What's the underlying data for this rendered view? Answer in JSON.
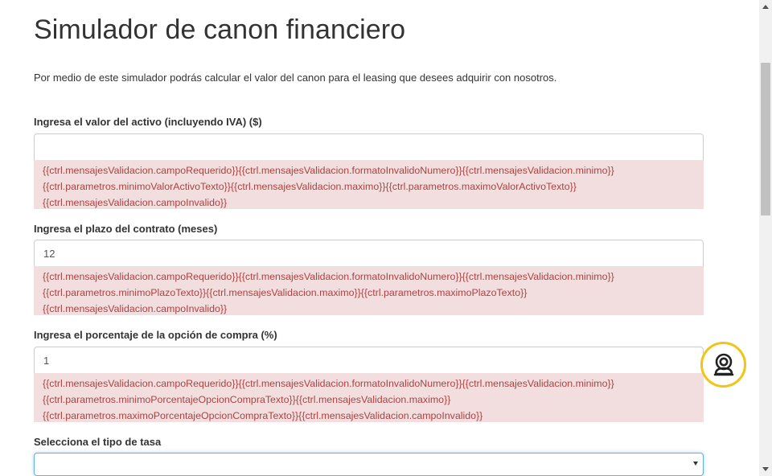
{
  "page": {
    "title": "Simulador de canon financiero",
    "intro": "Por medio de este simulador podrás calcular el valor del canon para el leasing que desees adquirir con nosotros."
  },
  "fields": [
    {
      "label": "Ingresa el valor del activo (incluyendo IVA) ($)",
      "value": "",
      "errors": [
        "{{ctrl.mensajesValidacion.campoRequerido}}{{ctrl.mensajesValidacion.formatoInvalidoNumero}}{{ctrl.mensajesValidacion.minimo}}",
        "{{ctrl.parametros.minimoValorActivoTexto}}{{ctrl.mensajesValidacion.maximo}}{{ctrl.parametros.maximoValorActivoTexto}}",
        "{{ctrl.mensajesValidacion.campoInvalido}}"
      ]
    },
    {
      "label": "Ingresa el plazo del contrato (meses)",
      "value": "12",
      "errors": [
        "{{ctrl.mensajesValidacion.campoRequerido}}{{ctrl.mensajesValidacion.formatoInvalidoNumero}}{{ctrl.mensajesValidacion.minimo}}",
        "{{ctrl.parametros.minimoPlazoTexto}}{{ctrl.mensajesValidacion.maximo}}{{ctrl.parametros.maximoPlazoTexto}}",
        "{{ctrl.mensajesValidacion.campoInvalido}}"
      ]
    },
    {
      "label": "Ingresa el porcentaje de la opción de compra (%)",
      "value": "1",
      "errors": [
        "{{ctrl.mensajesValidacion.campoRequerido}}{{ctrl.mensajesValidacion.formatoInvalidoNumero}}{{ctrl.mensajesValidacion.minimo}}",
        "{{ctrl.parametros.minimoPorcentajeOpcionCompraTexto}}{{ctrl.mensajesValidacion.maximo}}",
        "{{ctrl.parametros.maximoPorcentajeOpcionCompraTexto}}{{ctrl.mensajesValidacion.campoInvalido}}"
      ]
    }
  ],
  "rate_select": {
    "label": "Selecciona el tipo de tasa",
    "value": ""
  },
  "help_button": {
    "icon": "support-agent-icon",
    "accent": "#f0c419"
  },
  "colors": {
    "error_bg": "#f2dede",
    "error_text": "#a94442",
    "focus": "#66afe9"
  }
}
